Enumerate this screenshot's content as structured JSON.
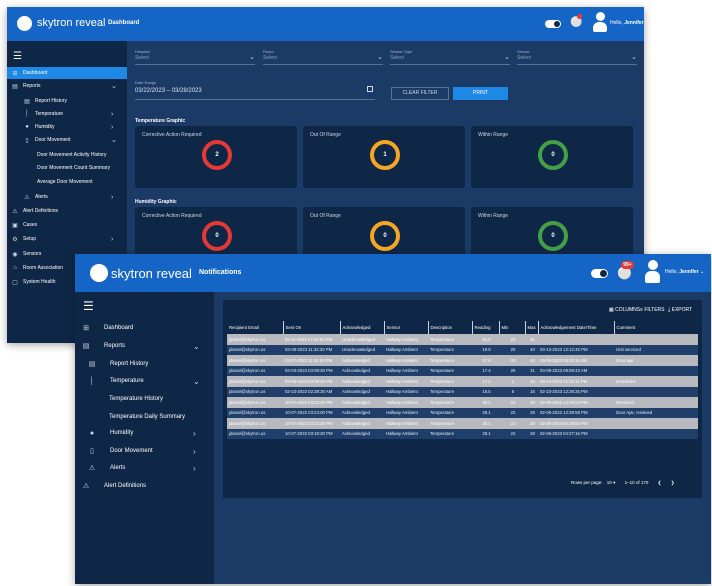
{
  "dashboard_window": {
    "brand": "skytron reveal",
    "page_name": "Dashboard",
    "hello_prefix": "Hello,",
    "user": "Jennifer",
    "menu_icon": "hamburger-icon",
    "sidebar": [
      {
        "label": "Dashboard",
        "icon": "grid-icon",
        "active": true
      },
      {
        "label": "Reports",
        "icon": "document-icon",
        "chevron": "down"
      },
      {
        "label": "Report History",
        "icon": "document-icon"
      },
      {
        "label": "Temperature",
        "icon": "thermometer-icon",
        "chevron": "right"
      },
      {
        "label": "Humidity",
        "icon": "droplet-icon",
        "chevron": "right"
      },
      {
        "label": "Door Movement",
        "icon": "door-icon",
        "chevron": "down"
      },
      {
        "label": "Door Movement Activity History"
      },
      {
        "label": "Door Movement Count Summary"
      },
      {
        "label": "Average Door Movement"
      },
      {
        "label": "Alerts",
        "icon": "warning-icon",
        "chevron": "right"
      },
      {
        "label": "Alert Definitions",
        "icon": "warning-icon"
      },
      {
        "label": "Cases",
        "icon": "case-icon"
      },
      {
        "label": "Setup",
        "icon": "gear-icon",
        "chevron": "right"
      },
      {
        "label": "Sensors",
        "icon": "signal-icon"
      },
      {
        "label": "Room Association",
        "icon": "home-icon"
      },
      {
        "label": "System Health",
        "icon": "monitor-icon"
      }
    ],
    "filters": [
      {
        "label": "Hospital",
        "value": "Select"
      },
      {
        "label": "Room",
        "value": "Select"
      },
      {
        "label": "Sensor Type",
        "value": "Select"
      },
      {
        "label": "Sensor",
        "value": "Select"
      }
    ],
    "date_range_label": "Date Range",
    "date_range_value": "03/22/2023 – 03/28/2023",
    "clear_filter": "CLEAR FILTER",
    "print": "PRINT",
    "temperature_title": "Temperature Graphic",
    "humidity_title": "Humidity Graphic",
    "temperature_cards": [
      {
        "title": "Corrective Action Required",
        "value": "2",
        "color": "#e53935"
      },
      {
        "title": "Out Of Range",
        "value": "1",
        "color": "#f5a623"
      },
      {
        "title": "Within Range",
        "value": "0",
        "color": "#43a047"
      }
    ],
    "humidity_cards": [
      {
        "title": "Corrective Action Required",
        "value": "0",
        "color": "#e53935"
      },
      {
        "title": "Out Of Range",
        "value": "0",
        "color": "#f5a623"
      },
      {
        "title": "Within Range",
        "value": "0",
        "color": "#43a047"
      }
    ]
  },
  "notifications_window": {
    "brand": "skytron reveal",
    "page_name": "Notifications",
    "hello_prefix": "Hello,",
    "user": "Jennifer",
    "badge": "99+",
    "menu_icon": "hamburger-icon",
    "sidebar": [
      {
        "label": "Dashboard",
        "icon": "grid-icon"
      },
      {
        "label": "Reports",
        "icon": "document-icon",
        "chevron": "down"
      },
      {
        "label": "Report History",
        "icon": "document-icon"
      },
      {
        "label": "Temperature",
        "icon": "thermometer-icon",
        "chevron": "down"
      },
      {
        "label": "Temperature History"
      },
      {
        "label": "Temperature Daily Summary"
      },
      {
        "label": "Humidity",
        "icon": "droplet-icon",
        "chevron": "right"
      },
      {
        "label": "Door Movement",
        "icon": "door-icon",
        "chevron": "right"
      },
      {
        "label": "Alerts",
        "icon": "warning-icon",
        "chevron": "right"
      },
      {
        "label": "Alert Definitions",
        "icon": "warning-icon"
      }
    ],
    "toolbar": {
      "columns": "COLUMNS",
      "filters": "FILTERS",
      "export": "EXPORT"
    },
    "columns": [
      "Recipient Email",
      "Sent On",
      "Acknowledged",
      "Sensor",
      "Description",
      "Reading",
      "Min",
      "Max",
      "Acknowledgement Date/Time",
      "Comment"
    ],
    "rows": [
      [
        "jdaniel@skytron.us",
        "03-11-2023 07:53:00 PM",
        "Unacknowledged",
        "Hallway Ambient",
        "Temperature",
        "21.9",
        "20",
        "31",
        "",
        ""
      ],
      [
        "jdaniel@skytron.us",
        "03-08-2023 11:32:30 PM",
        "Unacknowledged",
        "Hallway Ambient",
        "Temperature",
        "19.9",
        "20",
        "40",
        "03-13-2023 12:12:45 PM",
        "Unit serviced"
      ],
      [
        "jdaniel@skytron.us",
        "03-07-2023 11:45:30 PM",
        "Acknowledged",
        "Hallway Ambient",
        "Temperature",
        "17.9",
        "20",
        "40",
        "03-09-2023 05:40:11 AM",
        "Door ajar"
      ],
      [
        "jdaniel@skytron.us",
        "03-03-2023 03:08:30 PM",
        "Acknowledged",
        "Hallway Ambient",
        "Temperature",
        "17.4",
        "20",
        "31",
        "03-09-2023 09:59:43 AM",
        ""
      ],
      [
        "jdaniel@skytron.us",
        "03-03-2023 03:09:30 PM",
        "Acknowledged",
        "Hallway Ambient",
        "Temperature",
        "17.4",
        "1",
        "15",
        "03-13-2023 12:12:11 PM",
        "scheduled"
      ],
      [
        "jdaniel@skytron.us",
        "02-23-2023 02:38:30 AM",
        "Acknowledged",
        "Hallway Ambient",
        "Temperature",
        "18.5",
        "5",
        "15",
        "02-23-2023 12:29:26 PM",
        ""
      ],
      [
        "jdaniel@skytron.us",
        "10-07-2022 03:22:30 PM",
        "Acknowledged",
        "Hallway Ambient",
        "Temperature",
        "28.1",
        "22",
        "28",
        "02-06-2022 12:28:04 PM",
        "Resolved"
      ],
      [
        "jdaniel@skytron.us",
        "10-07-2022 03:24:00 PM",
        "Acknowledged",
        "Hallway Ambient",
        "Temperature",
        "28.1",
        "22",
        "28",
        "02-06-2022 12:28:59 PM",
        "Door Ajar, resolved"
      ],
      [
        "jdaniel@skytron.us",
        "10-07-2022 03:22:30 PM",
        "Acknowledged",
        "Hallway Ambient",
        "Temperature",
        "28.1",
        "22",
        "28",
        "02-06-2023 04:29:04 PM",
        ""
      ],
      [
        "jdaniel@skytron.us",
        "10-07-2022 03:18:30 PM",
        "Acknowledged",
        "Hallway Ambient",
        "Temperature",
        "28.1",
        "22",
        "28",
        "02-06-2023 04:27:16 PM",
        ""
      ]
    ],
    "pagination": {
      "rows_per_page_label": "Rows per page:",
      "rows_per_page": "10",
      "range": "1–10 of 170"
    }
  }
}
